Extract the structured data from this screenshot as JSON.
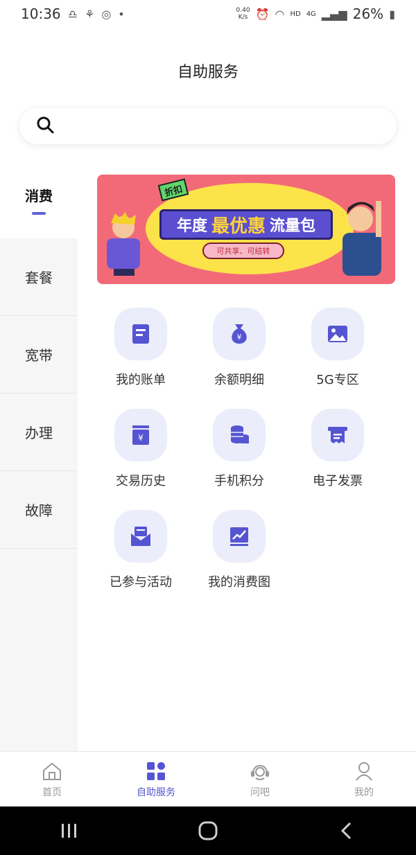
{
  "status_bar": {
    "time": "10:36",
    "net_speed_value": "0.40",
    "net_speed_unit": "K/s",
    "hd": "HD",
    "network": "4G",
    "battery": "26%"
  },
  "header": {
    "title": "自助服务"
  },
  "search": {
    "placeholder": ""
  },
  "sidebar": {
    "items": [
      {
        "label": "消费",
        "active": true
      },
      {
        "label": "套餐"
      },
      {
        "label": "宽带"
      },
      {
        "label": "办理"
      },
      {
        "label": "故障"
      }
    ]
  },
  "banner": {
    "tag": "折扣",
    "title_prefix": "年度",
    "title_highlight": "最优惠",
    "title_suffix": "流量包",
    "subtitle": "可共享、可结转"
  },
  "services": [
    {
      "label": "我的账单",
      "icon": "bill-icon"
    },
    {
      "label": "余额明细",
      "icon": "money-bag-icon"
    },
    {
      "label": "5G专区",
      "icon": "image-icon"
    },
    {
      "label": "交易历史",
      "icon": "transaction-icon"
    },
    {
      "label": "手机积分",
      "icon": "coins-icon"
    },
    {
      "label": "电子发票",
      "icon": "invoice-icon"
    },
    {
      "label": "已参与活动",
      "icon": "envelope-icon"
    },
    {
      "label": "我的消费图",
      "icon": "chart-icon"
    }
  ],
  "tabbar": {
    "items": [
      {
        "label": "首页",
        "active": false
      },
      {
        "label": "自助服务",
        "active": true
      },
      {
        "label": "问吧",
        "active": false
      },
      {
        "label": "我的",
        "active": false
      }
    ]
  },
  "colors": {
    "accent": "#5555d2",
    "icon_bg": "#ecedfb",
    "banner_bg": "#f26a78"
  }
}
